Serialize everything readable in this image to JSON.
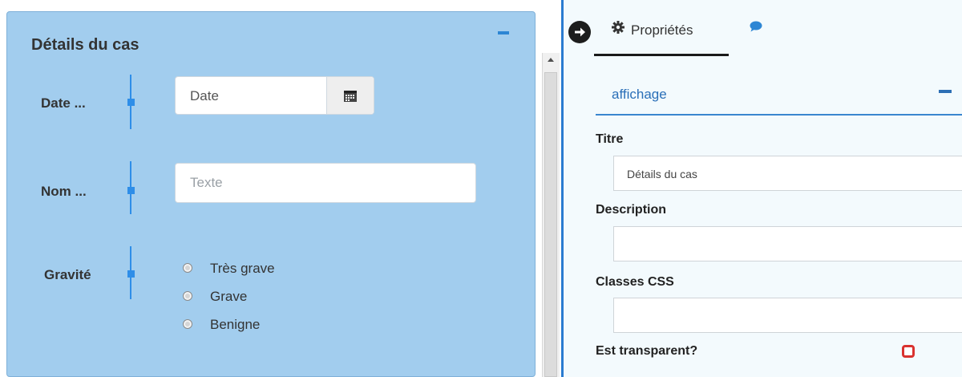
{
  "form_panel": {
    "title": "Détails du cas",
    "fields": {
      "date": {
        "label": "Date ...",
        "value": "Date"
      },
      "nom": {
        "label": "Nom ...",
        "placeholder": "Texte"
      },
      "gravite": {
        "label": "Gravité",
        "options": [
          "Très grave",
          "Grave",
          "Benigne"
        ]
      }
    }
  },
  "props_panel": {
    "tabs": {
      "properties": "Propriétés"
    },
    "section": "affichage",
    "fields": {
      "titre": {
        "label": "Titre",
        "value": "Détails du cas"
      },
      "description": {
        "label": "Description",
        "value": ""
      },
      "classes": {
        "label": "Classes CSS",
        "value": ""
      },
      "transparent": {
        "label": "Est transparent?",
        "checked": false
      }
    }
  },
  "colors": {
    "panel_bg": "#a2cdee",
    "accent": "#2e8ee8",
    "checkbox": "#d9322f"
  }
}
